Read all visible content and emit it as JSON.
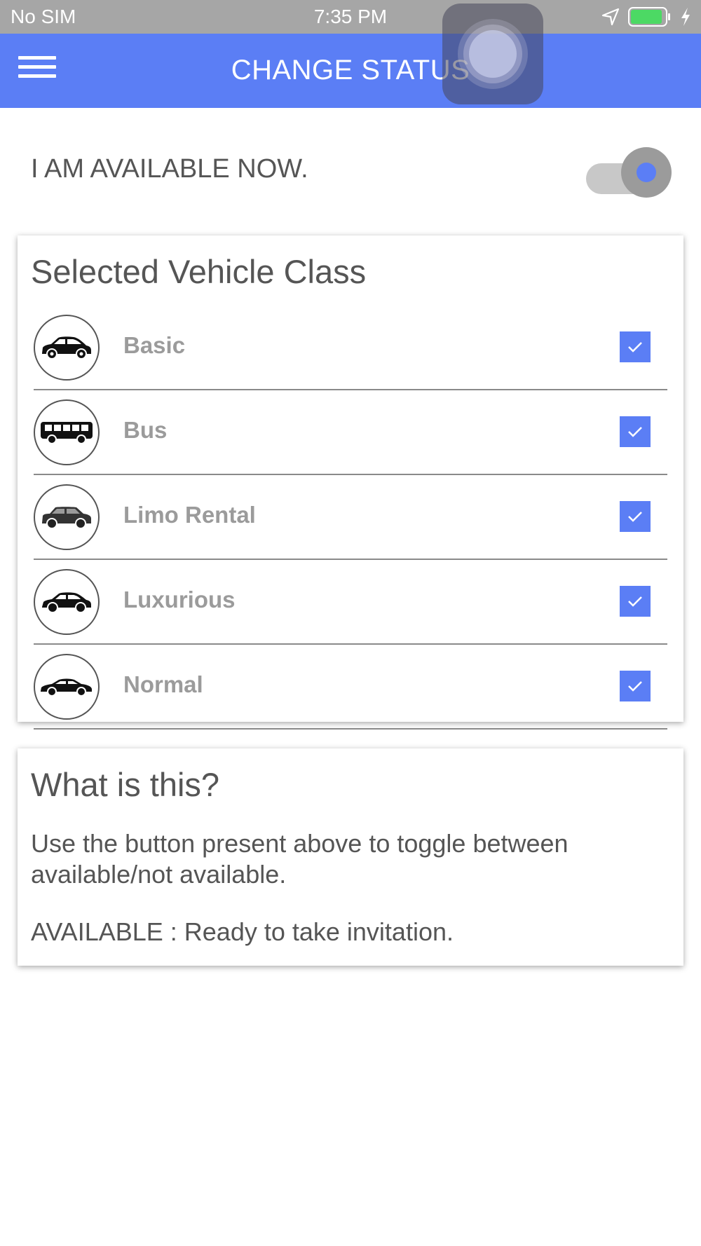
{
  "status_bar": {
    "carrier": "No SIM",
    "time": "7:35 PM",
    "icons": [
      "location-arrow-icon",
      "battery-icon",
      "charging-bolt-icon"
    ],
    "battery_color": "#4cd964"
  },
  "header": {
    "title": "CHANGE STATUS",
    "menu_icon": "hamburger-menu-icon",
    "background_color": "#5b7ef5"
  },
  "availability": {
    "label": "I AM AVAILABLE NOW.",
    "toggle_on": true,
    "accent_color": "#5b7ef5"
  },
  "vehicle_class": {
    "title": "Selected Vehicle Class",
    "items": [
      {
        "label": "Basic",
        "icon": "hatchback-car-icon",
        "checked": true
      },
      {
        "label": "Bus",
        "icon": "bus-icon",
        "checked": true
      },
      {
        "label": "Limo Rental",
        "icon": "suv-icon",
        "checked": true
      },
      {
        "label": "Luxurious",
        "icon": "hatchback-car-icon",
        "checked": true
      },
      {
        "label": "Normal",
        "icon": "sedan-car-icon",
        "checked": true
      }
    ]
  },
  "info": {
    "title": "What is this?",
    "description": "Use the button present above to toggle between available/not available.",
    "available_note": "AVAILABLE : Ready to take invitation."
  }
}
